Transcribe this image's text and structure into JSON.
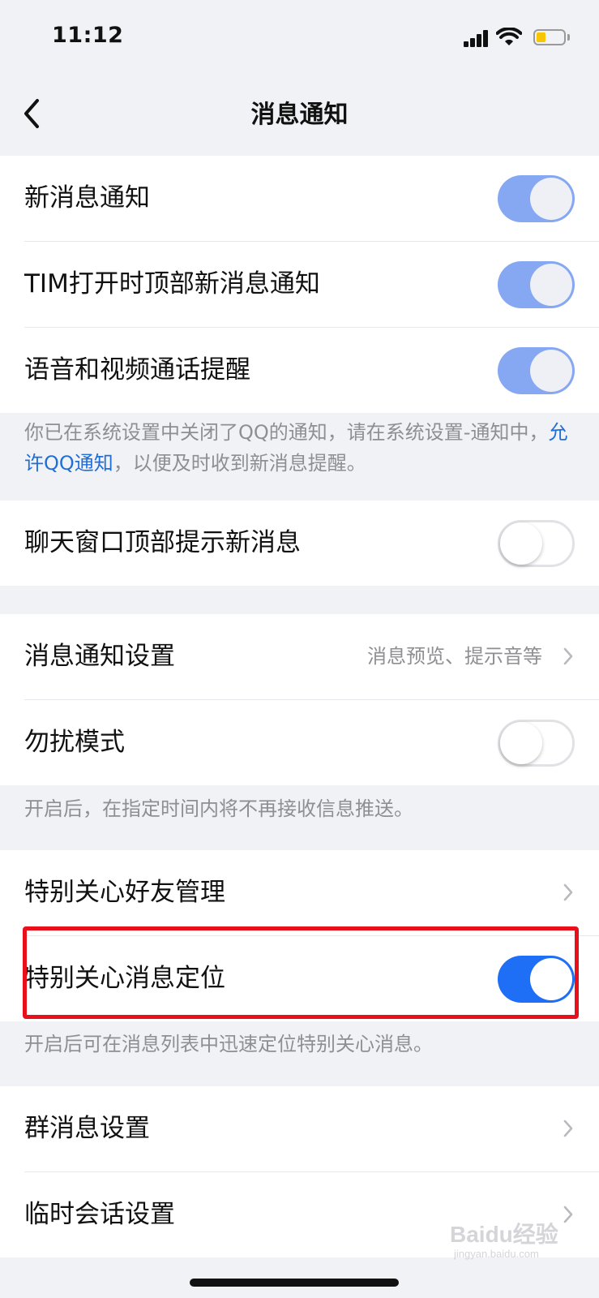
{
  "status_bar": {
    "time": "11:12",
    "battery_color": "#f7c600"
  },
  "nav": {
    "title": "消息通知",
    "back_icon": "chevron-left-icon"
  },
  "group1": {
    "rows": [
      {
        "label": "新消息通知",
        "toggle": "on"
      },
      {
        "label": "TIM打开时顶部新消息通知",
        "toggle": "on"
      },
      {
        "label": "语音和视频通话提醒",
        "toggle": "on"
      }
    ]
  },
  "note1": {
    "text_before": "你已在系统设置中关闭了QQ的通知，请在系统设置-通知中，",
    "link": "允许QQ通知",
    "text_after": "，以便及时收到新消息提醒。"
  },
  "group2": {
    "rows": [
      {
        "label": "聊天窗口顶部提示新消息",
        "toggle": "off"
      }
    ]
  },
  "group3": {
    "rows": [
      {
        "label": "消息通知设置",
        "value": "消息预览、提示音等"
      },
      {
        "label": "勿扰模式",
        "toggle": "off"
      }
    ]
  },
  "note2": {
    "text": "开启后，在指定时间内将不再接收信息推送。"
  },
  "group4": {
    "rows": [
      {
        "label": "特别关心好友管理"
      },
      {
        "label": "特别关心消息定位",
        "toggle": "on"
      }
    ]
  },
  "note3": {
    "text": "开启后可在消息列表中迅速定位特别关心消息。"
  },
  "group5": {
    "rows": [
      {
        "label": "群消息设置"
      },
      {
        "label": "临时会话设置"
      }
    ]
  },
  "watermark": {
    "text": "Baidu经验",
    "sub": "jingyan.baidu.com"
  },
  "colors": {
    "toggle_on_muted": "#86a8f2",
    "toggle_on": "#1e6ff5",
    "link": "#1f6fd8",
    "highlight_box": "#e8101a"
  }
}
